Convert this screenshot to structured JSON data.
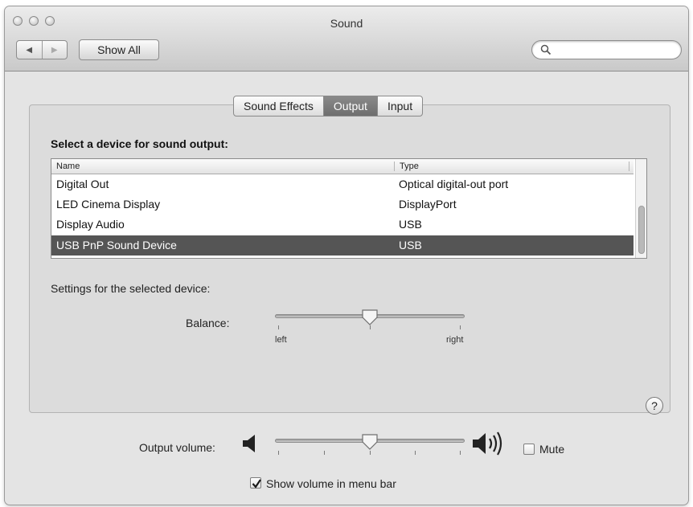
{
  "window": {
    "title": "Sound"
  },
  "toolbar": {
    "back_icon": "back-arrow-icon",
    "forward_icon": "forward-arrow-icon",
    "show_all_label": "Show All",
    "search_placeholder": "",
    "search_icon": "magnifier-icon"
  },
  "tabs": [
    {
      "label": "Sound Effects",
      "active": false
    },
    {
      "label": "Output",
      "active": true
    },
    {
      "label": "Input",
      "active": false
    }
  ],
  "output": {
    "heading": "Select a device for sound output:",
    "columns": {
      "name": "Name",
      "type": "Type"
    },
    "devices": [
      {
        "name": "Digital Out",
        "type": "Optical digital-out port",
        "selected": false
      },
      {
        "name": "LED Cinema Display",
        "type": "DisplayPort",
        "selected": false
      },
      {
        "name": "Display Audio",
        "type": "USB",
        "selected": false
      },
      {
        "name": "USB PnP Sound Device",
        "type": "USB",
        "selected": true
      }
    ],
    "settings_label": "Settings for the selected device:",
    "balance": {
      "label": "Balance:",
      "left_label": "left",
      "right_label": "right",
      "value": 0.5
    }
  },
  "help_label": "?",
  "volume": {
    "label": "Output volume:",
    "value": 0.5,
    "low_icon": "speaker-low-icon",
    "high_icon": "speaker-high-icon",
    "mute_label": "Mute",
    "mute_checked": false,
    "show_in_menubar_label": "Show volume in menu bar",
    "show_in_menubar_checked": true
  },
  "colors": {
    "selection": "#555555",
    "active_tab": "#7a7a7a",
    "window_bg": "#e4e4e4"
  }
}
